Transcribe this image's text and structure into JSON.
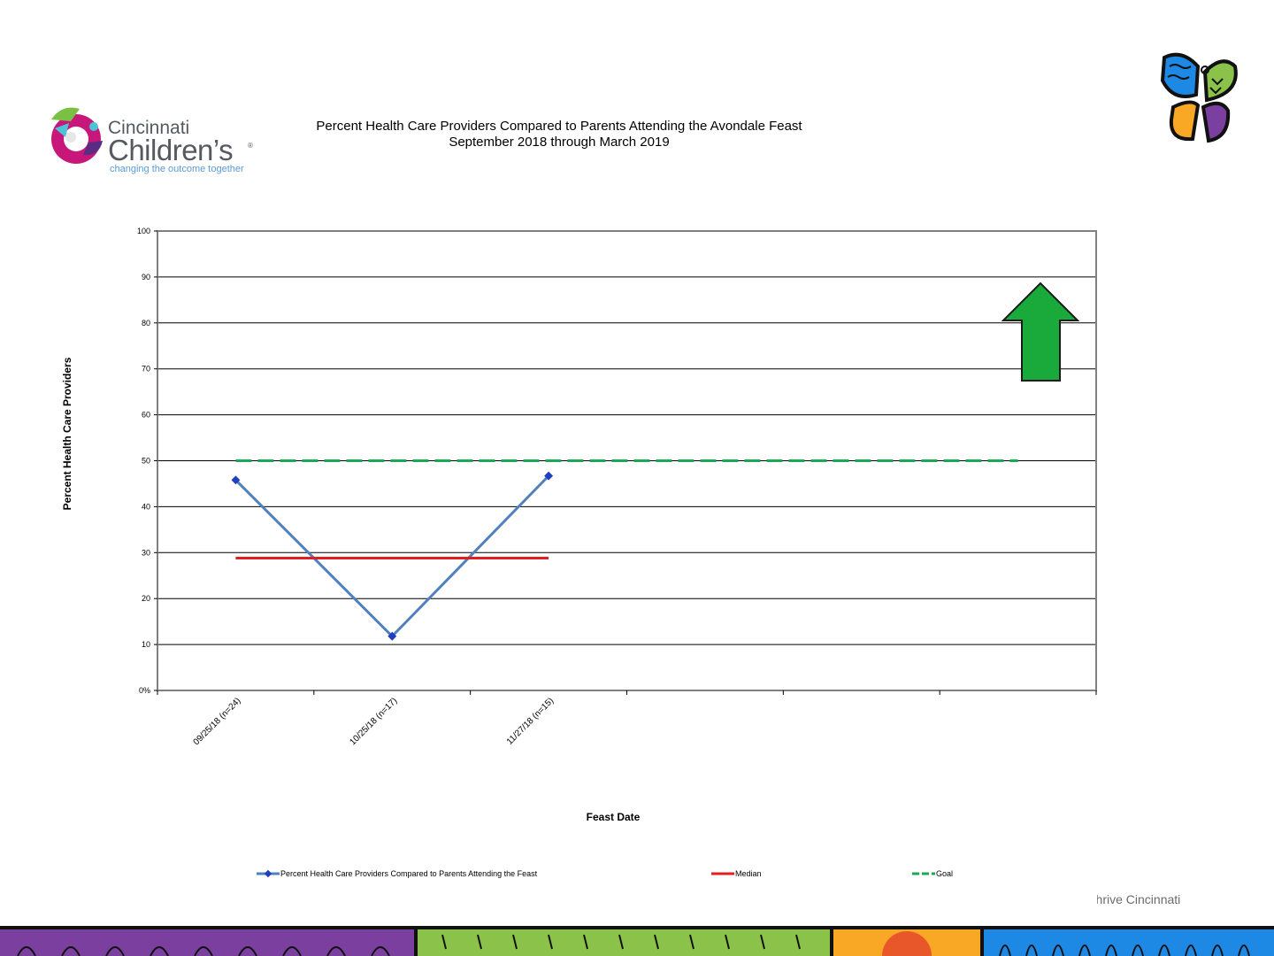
{
  "logo": {
    "line1": "Cincinnati",
    "line2": "Children’s",
    "reg": "®",
    "tagline": "changing the outcome together"
  },
  "footer": {
    "text": "Thrive Cincinnati"
  },
  "colors": {
    "series": "#4f81bd",
    "series_marker": "#1f3fbf",
    "median": "#e02020",
    "goal": "#1aaa55",
    "arrow": "#1aaa3c"
  },
  "icons": {
    "arrow": "up-arrow-icon",
    "butterfly": "butterfly-logo-icon"
  },
  "chart_data": {
    "type": "line",
    "title": "Percent  Health Care Providers Compared to Parents Attending the Avondale Feast",
    "subtitle": "September 2018 through March 2019",
    "xlabel": "Feast Date",
    "ylabel": "Percent Health Care Providers",
    "ylim": [
      0,
      100
    ],
    "yticks": [
      0,
      10,
      20,
      30,
      40,
      50,
      60,
      70,
      80,
      90,
      100
    ],
    "ytick_labels": [
      "0%",
      "10",
      "20",
      "30",
      "40",
      "50",
      "60",
      "70",
      "80",
      "90",
      "100"
    ],
    "categories": [
      "09/25/18 (n=24)",
      "10/25/18 (n=17)",
      "11/27/18 (n=15)",
      "",
      "",
      ""
    ],
    "grid": true,
    "legend": "bottom",
    "series": [
      {
        "name": "Percent Health Care Providers Compared to Parents Attending the Feast",
        "values": [
          45.8,
          11.8,
          46.7,
          null,
          null,
          null
        ],
        "style": "line-marker"
      },
      {
        "name": "Median",
        "values": [
          28.8,
          28.8,
          28.8,
          null,
          null,
          null
        ],
        "style": "solid"
      },
      {
        "name": "Goal",
        "values": [
          50,
          50,
          50,
          50,
          50,
          50
        ],
        "style": "dashed"
      }
    ]
  }
}
